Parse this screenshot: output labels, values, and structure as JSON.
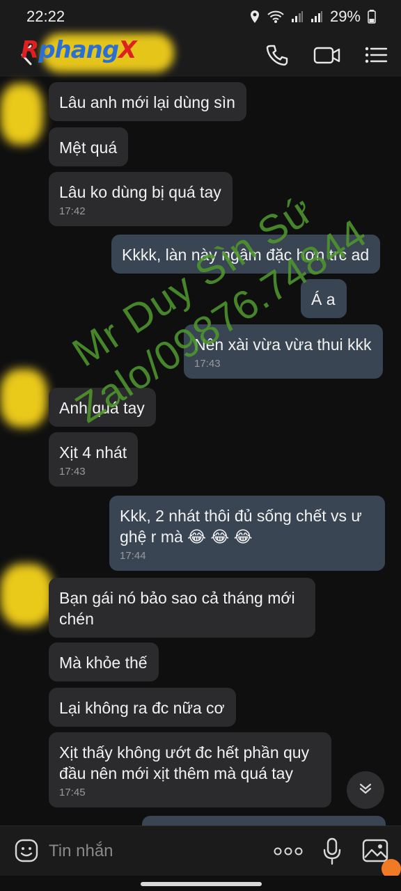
{
  "status_bar": {
    "time": "22:22",
    "battery": "29%"
  },
  "header": {
    "brand_prefix": "R",
    "brand_main": "phang",
    "brand_suffix": "X",
    "icons": [
      "back-icon",
      "phone-icon",
      "video-call-icon",
      "menu-list-icon"
    ]
  },
  "messages": [
    {
      "side": "in",
      "text": "Lâu anh mới lại dùng sìn",
      "time": ""
    },
    {
      "side": "in",
      "text": "Mệt quá",
      "time": ""
    },
    {
      "side": "in",
      "text": "Lâu ko dùng bị quá tay",
      "time": "17:42"
    },
    {
      "side": "out",
      "text": "Kkkk, làn này ngâm đặc hơn trc ad",
      "time": ""
    },
    {
      "side": "out",
      "text": "Á a",
      "time": ""
    },
    {
      "side": "out",
      "text": "Nên xài vừa vừa thui kkk",
      "time": "17:43"
    },
    {
      "side": "in",
      "text": "Anh quá tay",
      "time": ""
    },
    {
      "side": "in",
      "text": "Xịt 4 nhát",
      "time": "17:43"
    },
    {
      "side": "out",
      "text": "Kkk, 2 nhát thôi đủ sống chết vs ư",
      "text2": "ghệ r mà 😂 😂 😂",
      "time": "17:44"
    },
    {
      "side": "in",
      "text": "Bạn gái nó bảo sao cả tháng mới",
      "text2": "chén",
      "time": ""
    },
    {
      "side": "in",
      "text": "Mà khỏe thế",
      "time": ""
    },
    {
      "side": "in",
      "text": "Lại không ra đc nữa cơ",
      "time": ""
    },
    {
      "side": "in",
      "text": "Xịt thấy không ướt đc hết phần quy",
      "text2": "đầu nên mới xịt thêm mà quá tay",
      "time": "17:45"
    }
  ],
  "watermark": {
    "line1": "Mr Duy Sìn Sứ",
    "line2": "Zalo/09876.74844"
  },
  "composer": {
    "placeholder": "Tin nhắn"
  },
  "colors": {
    "background": "#0f0f10",
    "incoming_bubble": "#2b2b2d",
    "outgoing_bubble": "#3a4554",
    "watermark": "#4e962c",
    "redaction": "#f1cf1b"
  }
}
